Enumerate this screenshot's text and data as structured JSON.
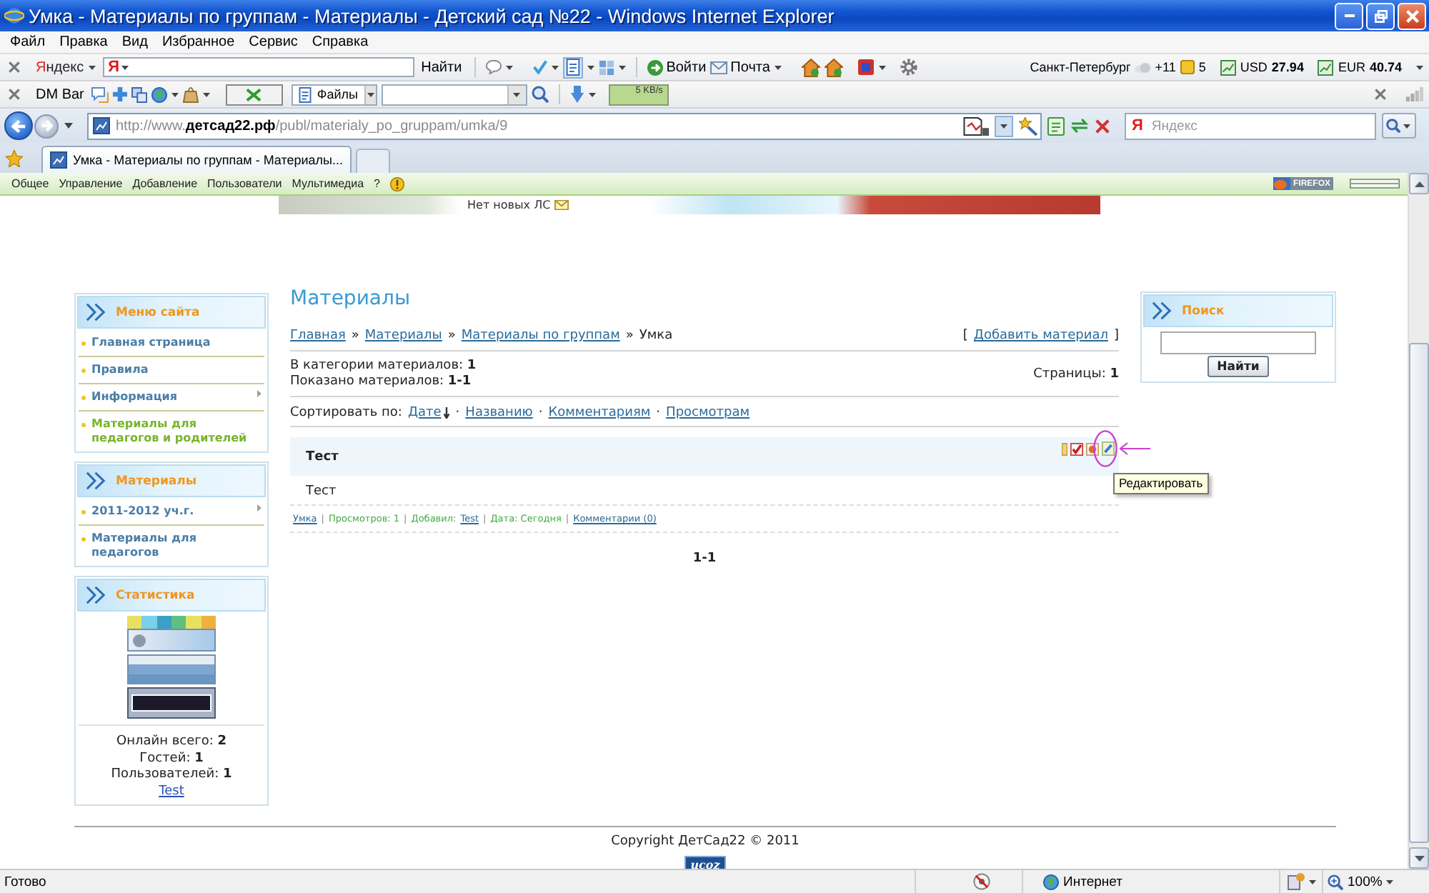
{
  "window": {
    "title": "Умка - Материалы по группам - Материалы - Детский сад №22 - Windows Internet Explorer"
  },
  "menu": [
    "Файл",
    "Правка",
    "Вид",
    "Избранное",
    "Сервис",
    "Справка"
  ],
  "yandex_bar": {
    "brand": "Яндекс",
    "field_logo": "Я",
    "search_button": "Найти",
    "login": "Войти",
    "mail": "Почта",
    "city": "Санкт-Петербург",
    "temperature": "+11",
    "traffic": "5",
    "currencies": [
      {
        "code": "USD",
        "rate": "27.94"
      },
      {
        "code": "EUR",
        "rate": "40.74"
      }
    ]
  },
  "dm_bar": {
    "label": "DM Bar",
    "files": "Файлы",
    "speed": "5 KB/s"
  },
  "address_bar": {
    "url": "http://www.**детсад22.рф**/publ/materialy_po_gruppam/umka/9",
    "search_logo": "Я",
    "search_placeholder": "Яндекс"
  },
  "tabs": [
    {
      "label": "Умка - Материалы по группам - Материалы...",
      "selected": true
    }
  ],
  "admin_bar": {
    "items": [
      "Общее",
      "Управление",
      "Добавление",
      "Пользователи",
      "Мультимедиа",
      "?"
    ],
    "badge": "FIREFOX"
  },
  "header": {
    "messages": "Нет новых ЛС"
  },
  "left_blocks": [
    {
      "kind": "menu",
      "title": "Меню сайта",
      "items": [
        {
          "label": "Главная страница",
          "submenu": false,
          "selected": false
        },
        {
          "label": "Правила",
          "submenu": false,
          "selected": false
        },
        {
          "label": "Информация",
          "submenu": true,
          "selected": false
        },
        {
          "label": "Материалы для педагогов и родителей",
          "submenu": false,
          "selected": true
        }
      ]
    },
    {
      "kind": "menu",
      "title": "Материалы",
      "items": [
        {
          "label": "2011-2012 уч.г.",
          "submenu": true,
          "selected": false
        },
        {
          "label": "Материалы для педагогов",
          "submenu": false,
          "selected": false
        }
      ]
    },
    {
      "kind": "stats",
      "title": "Статистика",
      "lines": [
        "Онлайн всего: **2**",
        "Гостей: **1**",
        "Пользователей: **1**"
      ],
      "user": "Test"
    }
  ],
  "content": {
    "title": "Материалы",
    "breadcrumbs": [
      {
        "label": "Главная",
        "link": true
      },
      {
        "label": "Материалы",
        "link": true
      },
      {
        "label": "Материалы по группам",
        "link": true
      },
      {
        "label": "Умка",
        "link": false
      }
    ],
    "breadcrumb_separator": "»",
    "add_link": {
      "open": "[",
      "label": "Добавить материал",
      "close": "]"
    },
    "counts": [
      "В категории материалов: **1**",
      "Показано материалов: **1-1**"
    ],
    "pages": "Страницы: **1**",
    "sort": {
      "label": "Сортировать по:",
      "separator": "·",
      "options": [
        {
          "label": "Дате",
          "selected": true
        },
        {
          "label": "Названию",
          "selected": false
        },
        {
          "label": "Комментариям",
          "selected": false
        },
        {
          "label": "Просмотрам",
          "selected": false
        }
      ]
    },
    "entries": [
      {
        "title": "Тест",
        "body": "Тест",
        "details": [
          {
            "kind": "link",
            "text": "Умка"
          },
          {
            "kind": "text",
            "text": "Просмотров: 1"
          },
          {
            "kind": "link",
            "label": "Добавил:",
            "text": "Test"
          },
          {
            "kind": "text",
            "text": "Дата: Сегодня"
          },
          {
            "kind": "link",
            "text": "Комментарии (0)"
          }
        ]
      }
    ],
    "details_separator": "|",
    "pagination": "1-1"
  },
  "tooltip": {
    "text": "Редактировать"
  },
  "right_blocks": [
    {
      "title": "Поиск",
      "button": "Найти"
    }
  ],
  "footer": {
    "copyright": "Copyright ДетСад22 © 2011",
    "badge": "ucoz"
  },
  "status_bar": {
    "text": "Готово",
    "zone": "Интернет",
    "zoom": "100%"
  }
}
